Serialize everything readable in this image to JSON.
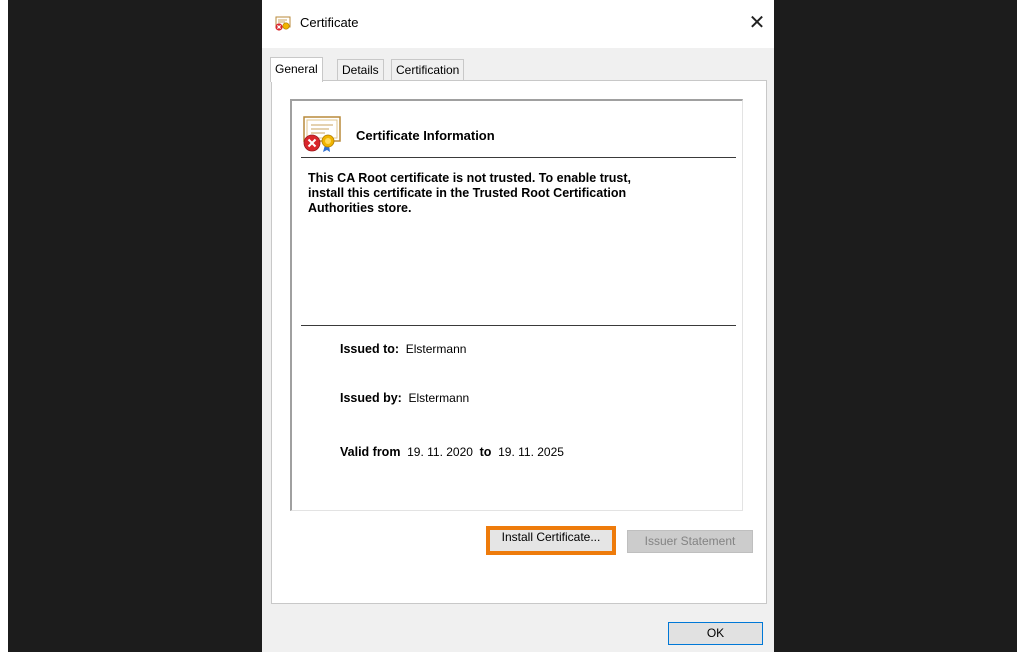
{
  "dialog": {
    "title": "Certificate",
    "close_glyph": "✕",
    "ok_label": "OK"
  },
  "tabs": [
    {
      "label": "General",
      "active": true
    },
    {
      "label": "Details",
      "active": false
    },
    {
      "label": "Certification Path",
      "active": false
    }
  ],
  "general": {
    "info_title": "Certificate Information",
    "warning_lines": [
      "This CA Root certificate is not trusted. To enable trust,",
      "install this certificate in the Trusted Root Certification",
      "Authorities store."
    ],
    "issued_to_label": "Issued to:",
    "issued_to_value": "Elstermann",
    "issued_by_label": "Issued by:",
    "issued_by_value": "Elstermann",
    "valid_from_label": "Valid from",
    "valid_from_value": "19. 11. 2020",
    "valid_to_label": "to",
    "valid_to_value": "19. 11. 2025",
    "install_button": "Install Certificate...",
    "issuer_statement_button": "Issuer Statement"
  },
  "colors": {
    "highlight": "#ee7b0b",
    "ok_border": "#0078d7",
    "error_badge": "#d9262b",
    "seal": "#f0b400"
  },
  "icons": {
    "title": "certificate-icon",
    "info": "certificate-error-icon",
    "close": "close-icon"
  }
}
